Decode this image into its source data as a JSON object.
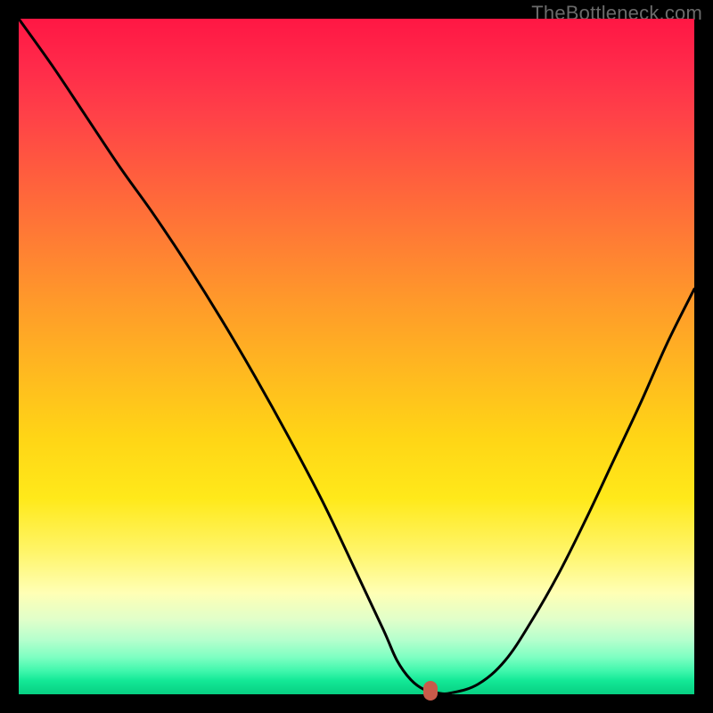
{
  "watermark": "TheBottleneck.com",
  "chart_data": {
    "type": "line",
    "title": "",
    "xlabel": "",
    "ylabel": "",
    "xlim": [
      0,
      100
    ],
    "ylim": [
      0,
      100
    ],
    "x": [
      0,
      5,
      10,
      15,
      20,
      25,
      30,
      35,
      40,
      45,
      50,
      54,
      56,
      58,
      60,
      62,
      64,
      68,
      72,
      76,
      80,
      84,
      88,
      92,
      96,
      100
    ],
    "values": [
      100,
      93,
      85.5,
      78,
      71,
      63.5,
      55.5,
      47,
      38,
      28.5,
      18,
      9.5,
      5,
      2.2,
      0.7,
      0.2,
      0.2,
      1.5,
      5,
      11,
      18,
      26,
      34.5,
      43,
      52,
      60
    ],
    "marker": {
      "x": 61,
      "y": 0.5
    },
    "gradient_stops": [
      {
        "pos": 0,
        "color": "#ff1744"
      },
      {
        "pos": 0.5,
        "color": "#ffd516"
      },
      {
        "pos": 0.82,
        "color": "#fff56a"
      },
      {
        "pos": 1.0,
        "color": "#07cf82"
      }
    ]
  }
}
